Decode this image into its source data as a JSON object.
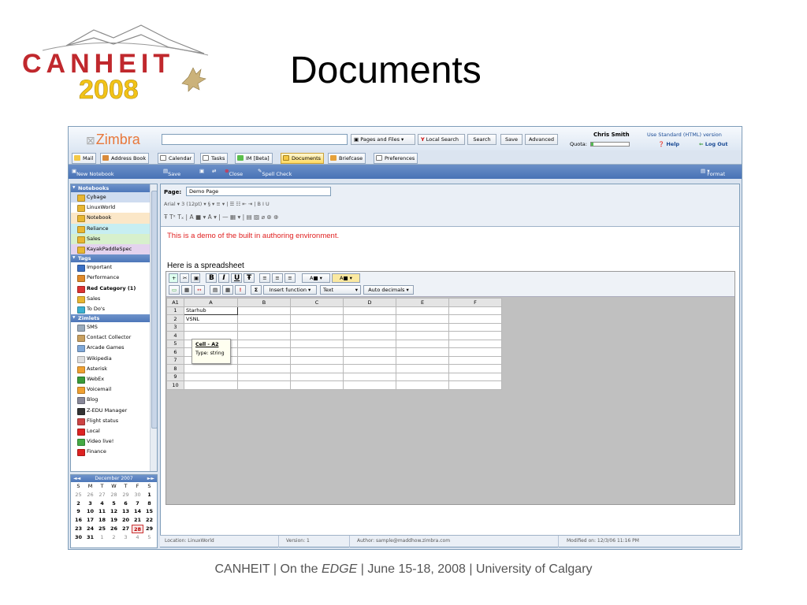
{
  "slide": {
    "logo_text": "CANHEIT",
    "logo_year": "2008",
    "title": "Documents",
    "footer_prefix": "CANHEIT | On the ",
    "footer_em": "EDGE",
    "footer_suffix": " | June 15-18, 2008 | University of Calgary"
  },
  "zimbra": {
    "logo_mark": "⊠",
    "logo_word": "Zimbra",
    "search_placeholder": "",
    "search_scope": "Pages and Files",
    "local_search": "Local Search",
    "search_button": "Search",
    "save_button": "Save",
    "advanced_button": "Advanced",
    "user_name": "Chris Smith",
    "quota_label": "Quota:",
    "standard_link": "Use Standard (HTML) version",
    "help_link": "Help",
    "logout_link": "Log Out",
    "app_tabs": [
      "Mail",
      "Address Book",
      "Calendar",
      "Tasks",
      "IM [Beta]",
      "Documents",
      "Briefcase",
      "Preferences"
    ],
    "new_notebook": "New Notebook",
    "toolbar": {
      "save": "Save",
      "close": "Close",
      "spell_check": "Spell Check",
      "format": "Format"
    },
    "sidebar": {
      "notebooks_header": "Notebooks",
      "notebooks": [
        "Cybage",
        "LinuxWorld",
        "Notebook",
        "Reliance",
        "Sales",
        "KayakPaddleSpec"
      ],
      "tags_header": "Tags",
      "tags": [
        "Important",
        "Performance",
        "Red Category (1)",
        "Sales",
        "To Do's"
      ],
      "zimlets_header": "Zimlets",
      "zimlets": [
        "SMS",
        "Contact Collector",
        "Arcade Games",
        "Wikipedia",
        "Asterisk",
        "WebEx",
        "Voicemail",
        "Blog",
        "Z-EDU Manager",
        "Flight status",
        "Local",
        "Video live!",
        "Finance"
      ]
    },
    "calendar": {
      "month": "December 2007",
      "weekdays": [
        "S",
        "M",
        "T",
        "W",
        "T",
        "F",
        "S"
      ],
      "days": [
        "25",
        "26",
        "27",
        "28",
        "29",
        "30",
        "1",
        "2",
        "3",
        "4",
        "5",
        "6",
        "7",
        "8",
        "9",
        "10",
        "11",
        "12",
        "13",
        "14",
        "15",
        "16",
        "17",
        "18",
        "19",
        "20",
        "21",
        "22",
        "23",
        "24",
        "25",
        "26",
        "27",
        "28",
        "29",
        "30",
        "31",
        "1",
        "2",
        "3",
        "4",
        "5"
      ],
      "today": "28"
    },
    "editor": {
      "page_label": "Page:",
      "page_name": "Demo Page",
      "format_row1": "Arial ▾   3 (12pt) ▾   § ▾   ≡ ▾  |  ☰  ☷  ⇤  ⇥  |  B   I   U",
      "format_row2": "Ŧ  Tˣ  Tₓ  |  A ■ ▾   A ▾  |  —   ▦ ▾  |  ▤  ▨  ⌀  ⊛  ⊕",
      "body_text": "This is a demo of the built in authoring environment.",
      "spreadsheet_heading": "Here is a spreadsheet",
      "insert_function": "Insert function",
      "text_format": "Text",
      "auto_decimals": "Auto decimals",
      "cell_ref": "A1",
      "columns": [
        "A",
        "B",
        "C",
        "D",
        "E",
        "F"
      ],
      "rows": [
        "1",
        "2",
        "3",
        "4",
        "5",
        "6",
        "7",
        "8",
        "9",
        "10"
      ],
      "cells": {
        "A1": "Starhub",
        "A2": "VSNL"
      },
      "tooltip_title": "Cell - A2",
      "tooltip_type": "Type: string"
    },
    "status": {
      "location": "Location: LinuxWorld",
      "version": "Version: 1",
      "author": "Author: sample@maddhow.zimbra.com",
      "modified": "Modified on: 12/3/06 11:16 PM"
    }
  }
}
